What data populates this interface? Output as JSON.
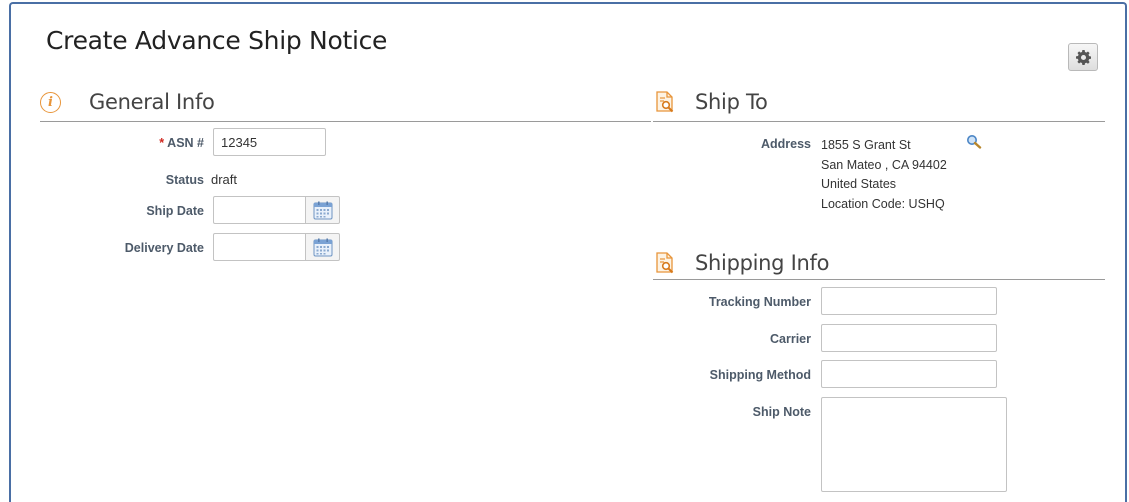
{
  "page": {
    "title": "Create Advance Ship Notice"
  },
  "toolbar": {
    "settings_icon": "gear-icon"
  },
  "general_info": {
    "title": "General Info",
    "icon": "info-icon",
    "asn_required_marker": "*",
    "asn_label": "ASN #",
    "asn_value": "12345",
    "status_label": "Status",
    "status_value": "draft",
    "ship_date_label": "Ship Date",
    "ship_date_value": "",
    "delivery_date_label": "Delivery Date",
    "delivery_date_value": ""
  },
  "ship_to": {
    "title": "Ship To",
    "icon": "document-search-icon",
    "address_label": "Address",
    "address_lines": [
      "1855 S Grant St",
      "San Mateo , CA 94402",
      "United States",
      "Location Code: USHQ"
    ],
    "lookup_icon": "magnifier-icon"
  },
  "shipping_info": {
    "title": "Shipping Info",
    "icon": "document-search-icon",
    "tracking_label": "Tracking Number",
    "tracking_value": "",
    "carrier_label": "Carrier",
    "carrier_value": "",
    "method_label": "Shipping Method",
    "method_value": "",
    "note_label": "Ship Note",
    "note_value": ""
  },
  "colors": {
    "accent_orange": "#e8953a",
    "required_red": "#d0281f",
    "label_gray": "#4d5a69",
    "frame_blue": "#4a6fa5"
  }
}
